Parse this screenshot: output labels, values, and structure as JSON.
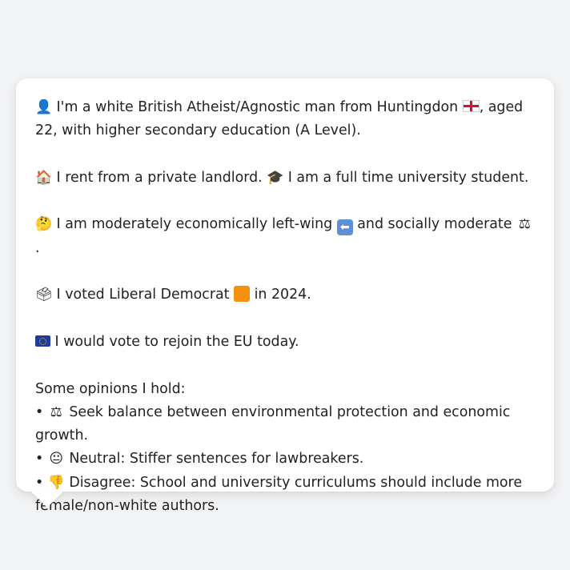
{
  "profile": {
    "identity": {
      "icon": "bust-in-silhouette-icon",
      "text_a": "I'm a white British Atheist/Agnostic man from Huntingdon",
      "flag": "england-flag-icon",
      "text_b": ", aged 22, with higher secondary education (A Level)."
    },
    "housing": {
      "icon": "house-icon",
      "text": "I rent from a private landlord.",
      "icon2": "graduation-cap-icon",
      "text2": "I am a full time university student."
    },
    "politics": {
      "icon": "thinking-face-icon",
      "text_a": "I am moderately economically left-wing",
      "arrow_icon": "left-arrow-icon",
      "text_b": "and socially moderate",
      "scales_icon": "balance-scale-icon",
      "text_c": "."
    },
    "vote": {
      "icon": "ballot-box-icon",
      "text_a": "I voted Liberal Democrat",
      "square_icon": "orange-square-icon",
      "party_color": "#f4900c",
      "text_b": "in 2024."
    },
    "eu": {
      "icon": "eu-flag-icon",
      "text": "I would vote to rejoin the EU today."
    },
    "opinions": {
      "heading": "Some opinions I hold:",
      "items": [
        {
          "bullet": "•",
          "icon": "balance-scale-icon",
          "text": "Seek balance between environmental protection and economic growth."
        },
        {
          "bullet": "•",
          "icon": "neutral-face-icon",
          "text": "Neutral: Stiffer sentences for lawbreakers."
        },
        {
          "bullet": "•",
          "icon": "thumbs-down-icon",
          "text": "Disagree: School and university curriculums should include more female/non-white authors."
        }
      ]
    }
  }
}
